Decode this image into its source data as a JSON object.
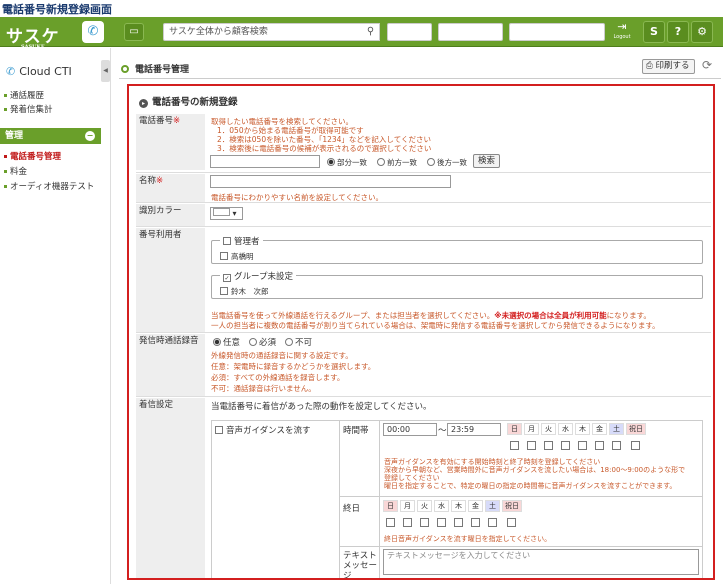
{
  "caption": "電話番号新規登録画面",
  "app": {
    "logo": "サスケ",
    "logo_sub": "SASUKE",
    "search_placeholder": "サスケ全体から顧客検索",
    "logout_label": "Logout"
  },
  "sidebar": {
    "product": "Cloud CTI",
    "links_top": [
      "通話履歴",
      "発着信集計"
    ],
    "section": "管理",
    "links_manage": [
      "電話番号管理",
      "料金",
      "オーディオ機器テスト"
    ]
  },
  "page": {
    "title": "電話番号管理",
    "print_button": "印刷する"
  },
  "form": {
    "title": "電話番号の新規登録",
    "phone": {
      "label": "電話番号",
      "required_mark": "※",
      "notes": [
        "取得したい電話番号を検索してください。",
        "1．050から始まる電話番号が取得可能です",
        "2．検索は050を除いた番号、「1234」などを記入してください",
        "3．検索後に電話番号の候補が表示されるので選択してください"
      ],
      "match_options": [
        "部分一致",
        "前方一致",
        "後方一致"
      ],
      "selected_match": "部分一致",
      "search_button": "検索"
    },
    "name": {
      "label": "名称",
      "required_mark": "※",
      "note": "電話番号にわかりやすい名前を設定してください。"
    },
    "color": {
      "label": "識別カラー"
    },
    "users": {
      "label": "番号利用者",
      "groups": [
        {
          "name": "管理者",
          "checked": false,
          "members": [
            {
              "name": "高橋明",
              "checked": false
            }
          ]
        },
        {
          "name": "グループ未設定",
          "checked": true,
          "members": [
            {
              "name": "鈴木　次郎",
              "checked": false
            }
          ]
        }
      ],
      "note_plain": "当電話番号を使って外線通話を行えるグループ、または担当者を選択してください。",
      "note_bold": "※未選択の場合は全員が利用可能",
      "note_tail": "になります。",
      "note2": "一人の担当者に複数の電話番号が割り当てられている場合は、架電時に発信する電話番号を選択してから発信できるようになります。"
    },
    "recording": {
      "label": "発信時通話録音",
      "options": [
        "任意",
        "必須",
        "不可"
      ],
      "selected": "任意",
      "notes": [
        "外線発信時の通話録音に関する設定です。",
        "任意：架電時に録音するかどうかを選択します。",
        "必須：すべての外線通話を録音します。",
        "不可：通話録音は行いません。"
      ]
    },
    "incoming": {
      "label": "着信設定",
      "description": "当電話番号に着信があった際の動作を設定してください。",
      "guidance_label": "音声ガイダンスを流す",
      "time_label": "時間帯",
      "time_from": "00:00",
      "time_sep": "〜",
      "time_to": "23:59",
      "days": [
        "日",
        "月",
        "火",
        "水",
        "木",
        "金",
        "土",
        "祝日"
      ],
      "time_notes": [
        "音声ガイダンスを有効にする開始時刻と終了時刻を登録してください",
        "深夜から早朝など、営業時間外に音声ガイダンスを流したい場合は、18:00〜9:00のような形で",
        "登録してください",
        "曜日を指定することで、特定の曜日の指定の時間帯に音声ガイダンスを流すことができます。"
      ],
      "allday_label": "終日",
      "allday_note": "終日音声ガイダンスを流す曜日を指定してください。",
      "text_label": "テキストメッセージ",
      "text_placeholder": "テキストメッセージを入力してください"
    }
  }
}
